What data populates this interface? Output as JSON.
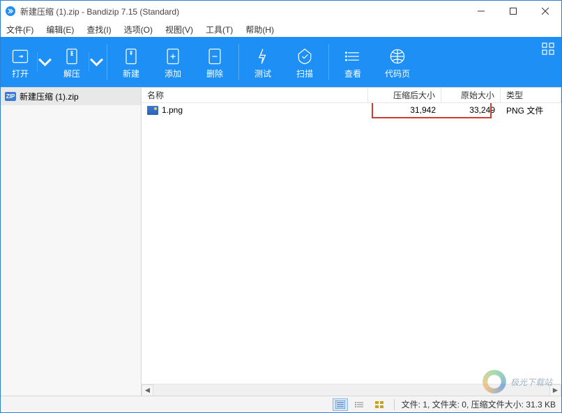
{
  "title": "新建压缩 (1).zip - Bandizip 7.15 (Standard)",
  "menu": {
    "file": "文件(F)",
    "edit": "编辑(E)",
    "find": "查找(I)",
    "options": "选项(O)",
    "view": "视图(V)",
    "tools": "工具(T)",
    "help": "帮助(H)"
  },
  "toolbar": {
    "open": "打开",
    "extract": "解压",
    "new": "新建",
    "add": "添加",
    "delete": "删除",
    "test": "测试",
    "scan": "扫描",
    "view": "查看",
    "codepage": "代码页"
  },
  "tree": {
    "zip_badge": "ZIP",
    "root": "新建压缩 (1).zip"
  },
  "columns": {
    "name": "名称",
    "compressed": "压缩后大小",
    "original": "原始大小",
    "type": "类型"
  },
  "rows": [
    {
      "name": "1.png",
      "compressed": "31,942",
      "original": "33,249",
      "type": "PNG 文件"
    }
  ],
  "status": "文件: 1, 文件夹: 0, 压缩文件大小: 31.3 KB",
  "watermark": "极光下载站"
}
